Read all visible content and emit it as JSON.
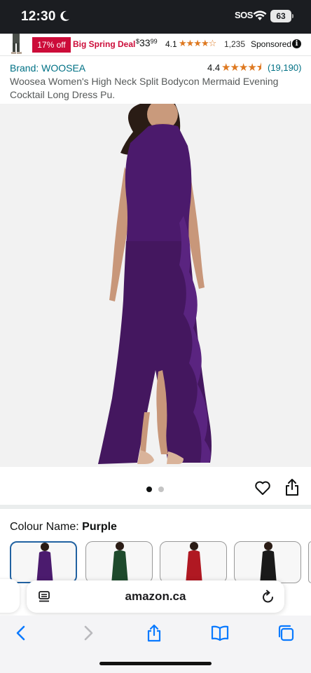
{
  "status_bar": {
    "time": "12:30",
    "sos": "SOS",
    "battery": "63"
  },
  "sponsored": {
    "discount_badge": "17% off",
    "deal_label": "Big Spring Deal",
    "price_currency": "$",
    "price_whole": "33",
    "price_cents": "99",
    "rating": "4.1",
    "rating_count": "1,235",
    "label": "Sponsored"
  },
  "product": {
    "brand": "Brand: WOOSEA",
    "rating": "4.4",
    "rating_count": "(19,190)",
    "title": "Woosea Women's High Neck Split Bodycon Mermaid Evening Cocktail Long Dress Pu."
  },
  "gallery": {
    "image_count": 2,
    "active_index": 0
  },
  "colour": {
    "label_prefix": "Colour Name: ",
    "selected": "Purple",
    "swatches": [
      {
        "name": "purple-swatch",
        "color": "#4b1b6e"
      },
      {
        "name": "green-swatch",
        "color": "#1e4a2c"
      },
      {
        "name": "red-swatch",
        "color": "#b01822"
      },
      {
        "name": "black-swatch",
        "color": "#1a1a1a"
      }
    ]
  },
  "browser": {
    "url": "amazon.ca"
  },
  "colors": {
    "link": "#007185",
    "star": "#de7921",
    "deal_red": "#cc0c39",
    "dress_purple": "#4b1a6c",
    "selected_border": "#2162a1"
  }
}
